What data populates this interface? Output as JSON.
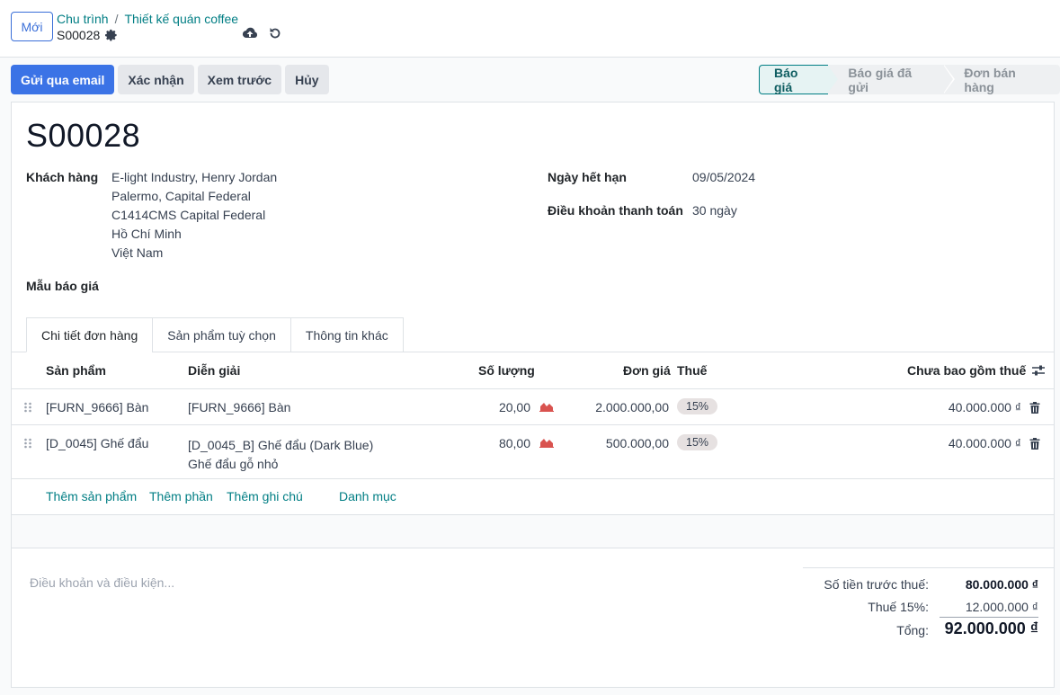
{
  "topbar": {
    "new_label": "Mới",
    "breadcrumb": [
      "Chu trình",
      "Thiết kế quán coffee"
    ],
    "record": "S00028"
  },
  "actions": {
    "send_email": "Gửi qua email",
    "confirm": "Xác nhận",
    "preview": "Xem trước",
    "cancel": "Hủy"
  },
  "statusbar": {
    "stages": [
      "Báo giá",
      "Báo giá đã gửi",
      "Đơn bán hàng"
    ],
    "active": "Báo giá"
  },
  "form": {
    "title": "S00028",
    "customer_label": "Khách hàng",
    "customer_lines": [
      "E-light Industry, Henry Jordan",
      "Palermo, Capital Federal",
      "C1414CMS Capital Federal",
      "Hồ Chí Minh",
      "Việt Nam"
    ],
    "template_label": "Mẫu báo giá",
    "expiry_label": "Ngày hết hạn",
    "expiry_value": "09/05/2024",
    "payment_terms_label": "Điều khoản thanh toán",
    "payment_terms_value": "30 ngày"
  },
  "tabs": [
    "Chi tiết đơn hàng",
    "Sản phẩm tuỳ chọn",
    "Thông tin khác"
  ],
  "table": {
    "headers": {
      "product": "Sản phẩm",
      "description": "Diễn giải",
      "quantity": "Số lượng",
      "unit_price": "Đơn giá",
      "tax": "Thuế",
      "subtotal": "Chưa bao gồm thuế"
    },
    "rows": [
      {
        "product": "[FURN_9666] Bàn",
        "description": "[FURN_9666] Bàn",
        "description2": "",
        "quantity": "20,00",
        "unit_price": "2.000.000,00",
        "tax": "15%",
        "subtotal": "40.000.000 ₫"
      },
      {
        "product": "[D_0045] Ghế đẩu",
        "description": "[D_0045_B] Ghế đẩu (Dark Blue)",
        "description2": "Ghế đẩu gỗ nhỏ",
        "quantity": "80,00",
        "unit_price": "500.000,00",
        "tax": "15%",
        "subtotal": "40.000.000 ₫"
      }
    ],
    "add_links": [
      "Thêm sản phẩm",
      "Thêm phần",
      "Thêm ghi chú",
      "Danh mục"
    ]
  },
  "terms_placeholder": "Điều khoản và điều kiện...",
  "totals": {
    "untaxed_label": "Số tiền trước thuế:",
    "untaxed_value": "80.000.000 ₫",
    "tax_label": "Thuế 15%:",
    "tax_value": "12.000.000 ₫",
    "total_label": "Tổng:",
    "total_value": "92.000.000 ₫"
  },
  "colors": {
    "primary": "#3b73e6",
    "link": "#017e84",
    "forecast_icon": "#d9534f"
  }
}
